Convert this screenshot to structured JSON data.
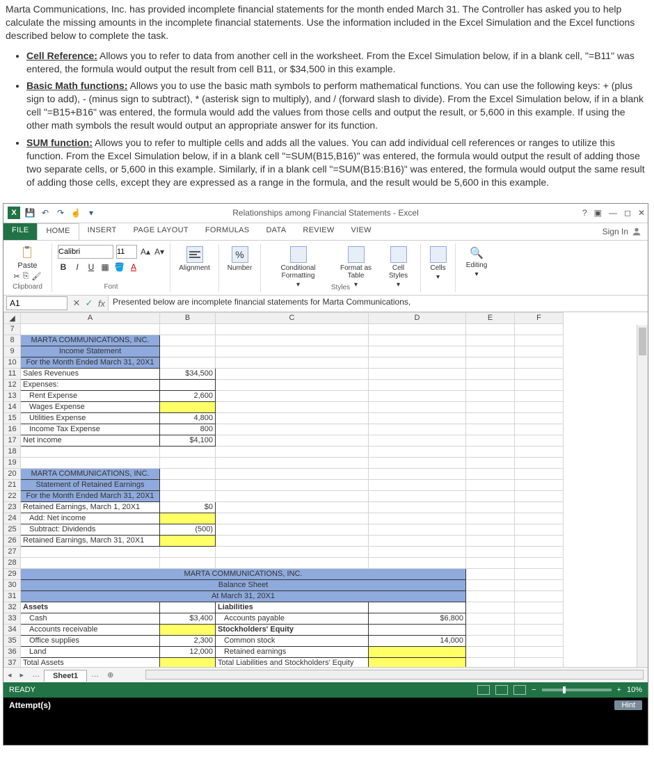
{
  "instructions": {
    "intro": "Marta Communications, Inc. has provided incomplete financial statements for the month ended March 31.  The Controller has asked you to help calculate the missing amounts in the incomplete financial statements.  Use the information included in the Excel Simulation and the Excel functions described below to complete the task.",
    "bullets": [
      {
        "term": "Cell Reference:",
        "text": "  Allows you to refer to data from another cell in the worksheet.  From the Excel Simulation below, if in a blank cell, \"=B11\" was entered, the formula would output the result from cell B11, or $34,500 in this example."
      },
      {
        "term": "Basic Math functions:",
        "text": "  Allows you to use the basic math symbols to perform mathematical functions.  You can use the following keys:  + (plus sign to add), - (minus sign to subtract), * (asterisk sign to multiply), and / (forward slash to divide).  From the Excel Simulation below, if in a blank cell \"=B15+B16\" was entered, the formula would add the values from those cells and output the result, or 5,600 in this example.  If using the other math symbols the result would output an appropriate answer for its function."
      },
      {
        "term": "SUM function:",
        "text": "  Allows you to refer to multiple cells and adds all the values.  You can add individual cell references or ranges to utilize this function.  From the Excel Simulation below, if in a blank cell \"=SUM(B15,B16)\" was entered, the formula would output the result of adding those two separate cells, or 5,600 in this example.  Similarly, if in a blank cell \"=SUM(B15:B16)\" was entered, the formula would output the same result of adding those cells, except they are expressed as a range in the formula, and the result would be 5,600 in this example."
      }
    ]
  },
  "titlebar": {
    "title": "Relationships among Financial Statements - Excel"
  },
  "tabs": {
    "file": "FILE",
    "home": "HOME",
    "insert": "INSERT",
    "layout": "PAGE LAYOUT",
    "formulas": "FORMULAS",
    "data": "DATA",
    "review": "REVIEW",
    "view": "VIEW",
    "signin": "Sign In"
  },
  "ribbon": {
    "paste": "Paste",
    "clipboard": "Clipboard",
    "font_name": "Calibri",
    "font_size": "11",
    "font": "Font",
    "alignment": "Alignment",
    "number": "Number",
    "pct": "%",
    "condfmt": "Conditional Formatting",
    "fmttable": "Format as Table",
    "cellstyles": "Cell Styles",
    "styles": "Styles",
    "cells": "Cells",
    "editing": "Editing"
  },
  "namebox": "A1",
  "formula_bar": "Presented below are incomplete financial statements for Marta Communications,",
  "cols": [
    "A",
    "B",
    "C",
    "D",
    "E",
    "F"
  ],
  "rows": {
    "r8a": "MARTA COMMUNICATIONS, INC.",
    "r9a": "Income Statement",
    "r10a": "For the Month Ended  March 31, 20X1",
    "r11a": "Sales Revenues",
    "r11b": "$34,500",
    "r12a": "Expenses:",
    "r13a": "Rent Expense",
    "r13b": "2,600",
    "r14a": "Wages Expense",
    "r15a": "Utilities Expense",
    "r15b": "4,800",
    "r16a": "Income Tax Expense",
    "r16b": "800",
    "r17a": "Net income",
    "r17b": "$4,100",
    "r20a": "MARTA COMMUNICATIONS, INC.",
    "r21a": "Statement of Retained Earnings",
    "r22a": "For the Month Ended  March 31, 20X1",
    "r23a": "Retained Earnings, March 1, 20X1",
    "r23b": "$0",
    "r24a": "Add: Net income",
    "r25a": "Subtract: Dividends",
    "r25b": "(500)",
    "r26a": "Retained Earnings, March 31, 20X1",
    "r29": "MARTA COMMUNICATIONS, INC.",
    "r30": "Balance Sheet",
    "r31": "At March 31, 20X1",
    "r32a": "Assets",
    "r32c": "Liabilities",
    "r33a": "Cash",
    "r33b": "$3,400",
    "r33c": "Accounts payable",
    "r33d": "$6,800",
    "r34a": "Accounts receivable",
    "r34c": "Stockholders' Equity",
    "r35a": "Office supplies",
    "r35b": "2,300",
    "r35c": "Common stock",
    "r35d": "14,000",
    "r36a": "Land",
    "r36b": "12,000",
    "r36c": "Retained earnings",
    "r37a": "Total Assets",
    "r37c": "Total Liabilities and Stockholders' Equity"
  },
  "sheet_tab": "Sheet1",
  "status_ready": "READY",
  "zoom": "10%",
  "attempts": "Attempt(s)",
  "hint": "Hint"
}
